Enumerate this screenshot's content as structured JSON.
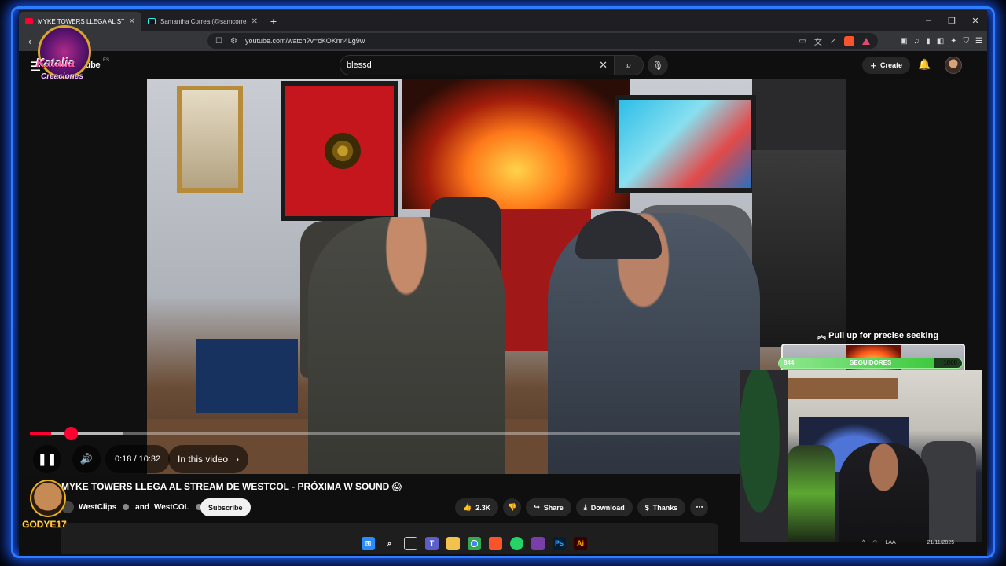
{
  "browser": {
    "tabs": [
      {
        "title": "MYKE TOWERS LLEGA AL STR",
        "favicon": "youtube-icon",
        "active": true
      },
      {
        "title": "Samantha Correa (@samcorreat) ofic",
        "favicon": "tiktok-icon",
        "active": false
      }
    ],
    "new_tab": "+",
    "url": "youtube.com/watch?v=cKOKnn4Lg9w",
    "window_controls": [
      "–",
      "❐",
      "✕"
    ]
  },
  "overlay_logo": {
    "line1": "Katalia",
    "line2": "Creaciones"
  },
  "youtube": {
    "logo": "YouTube",
    "country": "ES",
    "search_value": "blessd",
    "create_label": "Create"
  },
  "player": {
    "time_current": "0:18",
    "time_total": "10:32",
    "time_display": "0:18 / 10:32",
    "chapter_label": "In this video",
    "seek_hint": "Pull up for precise seeking",
    "progress_fraction": 0.03
  },
  "video": {
    "title": "MYKE TOWERS LLEGA AL STREAM DE WESTCOL - PRÓXIMA W SOUND 😱",
    "channel_1": "WestClips",
    "channel_joiner": "and",
    "channel_2": "WestCOL",
    "subscribe_label": "Subscribe",
    "likes": "2.3K",
    "share_label": "Share",
    "download_label": "Download",
    "thanks_label": "Thanks",
    "more": "⋯"
  },
  "stream_overlay": {
    "followers_current": "844",
    "followers_label": "SEGUIDORES",
    "followers_goal": "1000",
    "followers_fraction": 0.844,
    "streamer_name": "GODYE17"
  },
  "taskbar": {
    "icons": [
      "windows-icon",
      "search-icon",
      "taskview-icon",
      "teams-icon",
      "file-explorer-icon",
      "chrome-icon",
      "brave-icon",
      "whatsapp-icon",
      "winrar-icon",
      "photoshop-icon",
      "illustrator-icon"
    ],
    "tray_lang": "LAA",
    "date": "21/11/2025"
  },
  "colors": {
    "accent_red": "#ff0033",
    "glow_blue": "#2f7dff",
    "followers_green": "#3fc93f"
  }
}
